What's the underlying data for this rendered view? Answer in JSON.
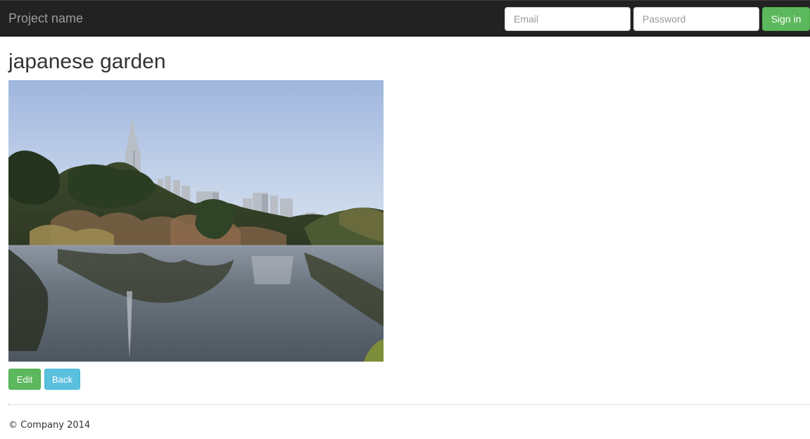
{
  "navbar": {
    "brand": "Project name",
    "email_placeholder": "Email",
    "password_placeholder": "Password",
    "signin_label": "Sign in"
  },
  "main": {
    "title": "japanese garden",
    "photo_alt": "japanese garden",
    "edit_label": "Edit",
    "back_label": "Back"
  },
  "footer": {
    "text": "© Company 2014"
  },
  "colors": {
    "navbar_bg": "#222222",
    "brand_text": "#9d9d9d",
    "success": "#5cb85c",
    "info": "#5bc0de"
  }
}
